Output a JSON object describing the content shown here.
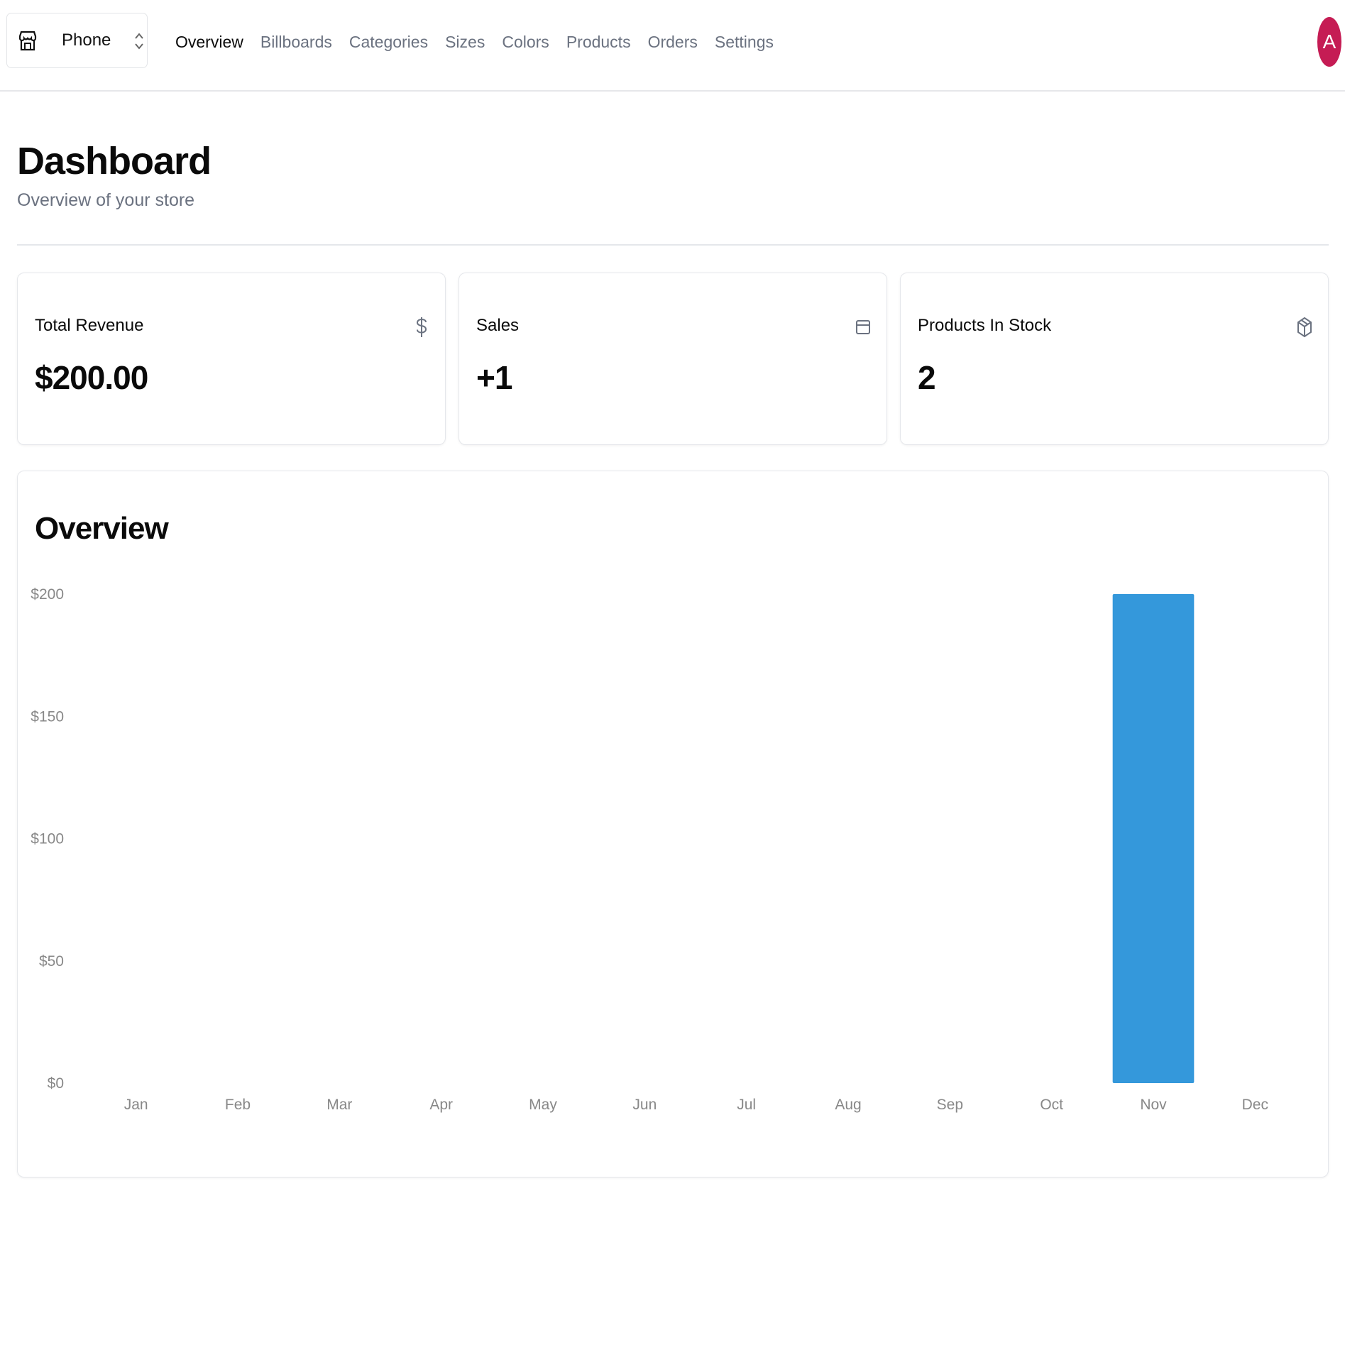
{
  "header": {
    "store_switcher": {
      "selected": "Phone",
      "icon": "store-icon",
      "chevron_icon": "chevrons-up-down-icon"
    },
    "nav": [
      {
        "label": "Overview",
        "active": true
      },
      {
        "label": "Billboards",
        "active": false
      },
      {
        "label": "Categories",
        "active": false
      },
      {
        "label": "Sizes",
        "active": false
      },
      {
        "label": "Colors",
        "active": false
      },
      {
        "label": "Products",
        "active": false
      },
      {
        "label": "Orders",
        "active": false
      },
      {
        "label": "Settings",
        "active": false
      }
    ],
    "avatar": {
      "initial": "A",
      "color": "#c51c54"
    }
  },
  "page": {
    "title": "Dashboard",
    "subtitle": "Overview of your store"
  },
  "stats": [
    {
      "label": "Total Revenue",
      "value": "$200.00",
      "icon": "dollar-sign-icon"
    },
    {
      "label": "Sales",
      "value": "+1",
      "icon": "credit-card-icon"
    },
    {
      "label": "Products In Stock",
      "value": "2",
      "icon": "package-icon"
    }
  ],
  "overview": {
    "title": "Overview"
  },
  "chart_data": {
    "type": "bar",
    "categories": [
      "Jan",
      "Feb",
      "Mar",
      "Apr",
      "May",
      "Jun",
      "Jul",
      "Aug",
      "Sep",
      "Oct",
      "Nov",
      "Dec"
    ],
    "values": [
      0,
      0,
      0,
      0,
      0,
      0,
      0,
      0,
      0,
      0,
      200,
      0
    ],
    "y_ticks": [
      "$0",
      "$50",
      "$100",
      "$150",
      "$200"
    ],
    "ylim": [
      0,
      200
    ],
    "bar_color": "#3498db",
    "grid": false,
    "title": "",
    "xlabel": "",
    "ylabel": ""
  }
}
